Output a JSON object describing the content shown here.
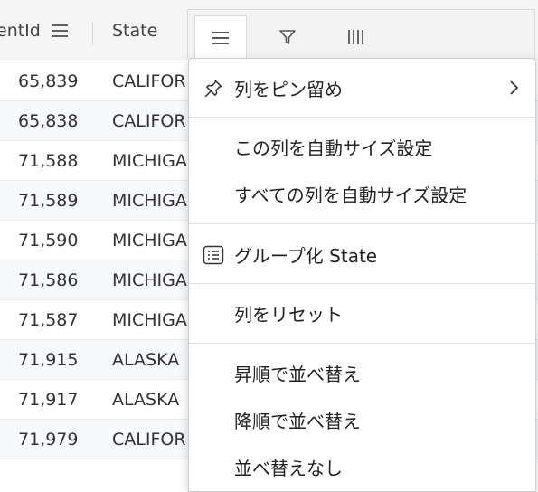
{
  "header": {
    "col_id_label": "entId",
    "col_state_label": "State"
  },
  "rows": [
    {
      "id": "65,839",
      "state": "CALIFOR"
    },
    {
      "id": "65,838",
      "state": "CALIFOR"
    },
    {
      "id": "71,588",
      "state": "MICHIGA"
    },
    {
      "id": "71,589",
      "state": "MICHIGA"
    },
    {
      "id": "71,590",
      "state": "MICHIGA"
    },
    {
      "id": "71,586",
      "state": "MICHIGA"
    },
    {
      "id": "71,587",
      "state": "MICHIGA"
    },
    {
      "id": "71,915",
      "state": "ALASKA"
    },
    {
      "id": "71,917",
      "state": "ALASKA"
    },
    {
      "id": "71,979",
      "state": "CALIFOR"
    }
  ],
  "menu_tabs": {
    "general_icon": "menu-lines-icon",
    "filter_icon": "filter-funnel-icon",
    "columns_icon": "columns-bars-icon"
  },
  "column_menu": {
    "pin_column": "列をピン留め",
    "autosize_this": "この列を自動サイズ設定",
    "autosize_all": "すべての列を自動サイズ設定",
    "group_by": "グループ化 State",
    "reset_columns": "列をリセット",
    "sort_asc": "昇順で並べ替え",
    "sort_desc": "降順で並べ替え",
    "no_sort": "並べ替えなし"
  }
}
